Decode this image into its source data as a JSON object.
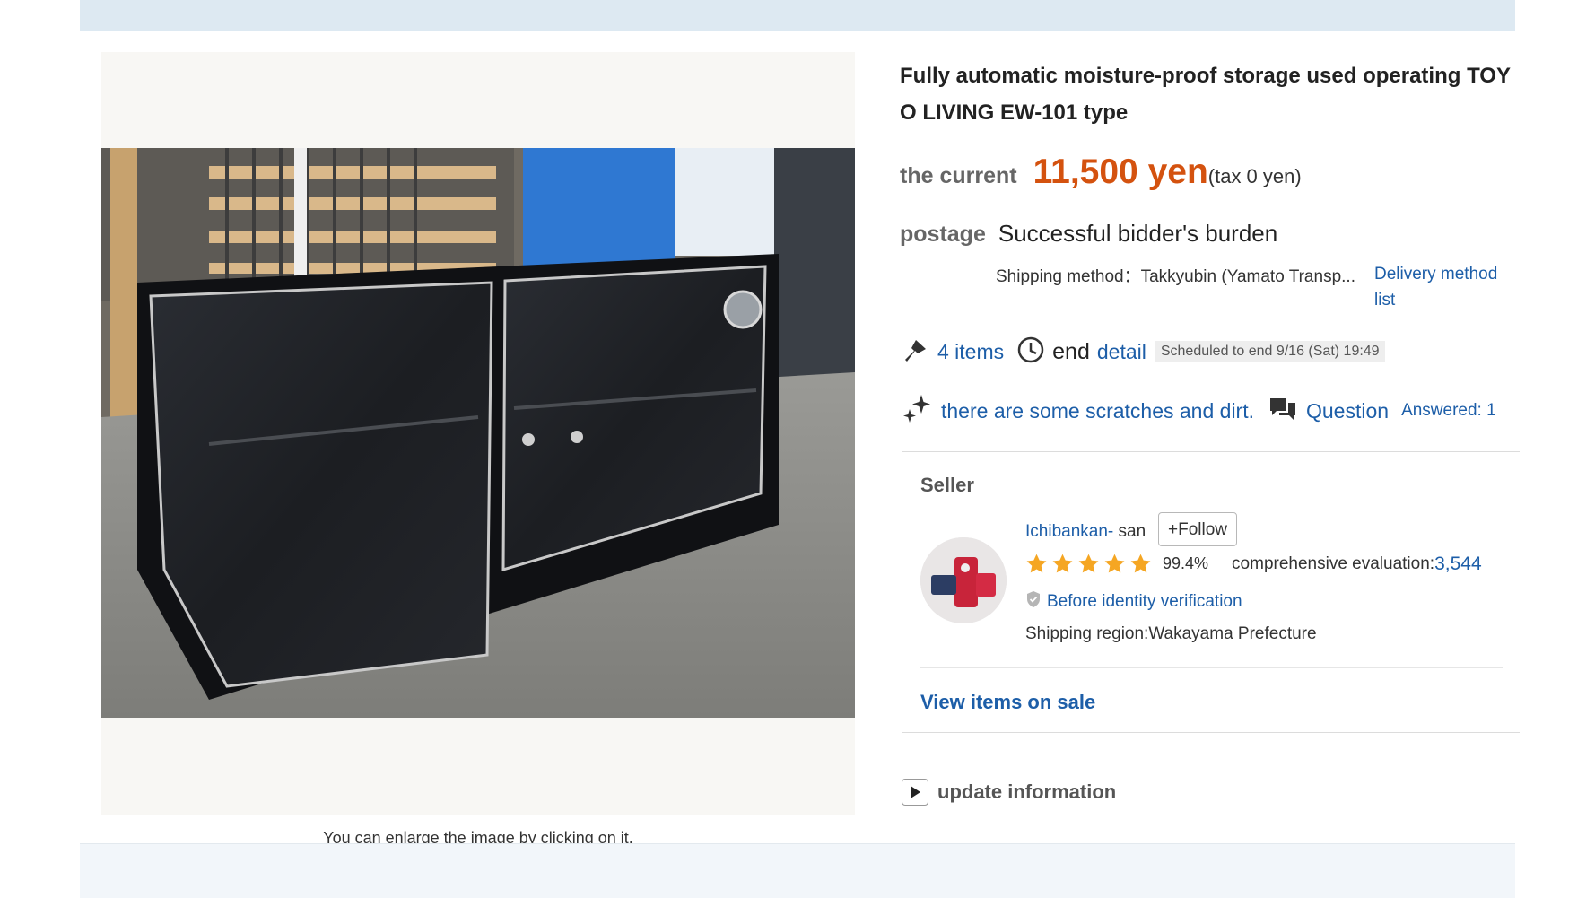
{
  "image": {
    "caption": "You can enlarge the image by clicking on it."
  },
  "item": {
    "title": "Fully automatic moisture-proof storage used operating TOYO LIVING EW-101 type"
  },
  "price": {
    "label": "the current",
    "amount": "11,500 yen",
    "tax": "(tax 0 yen)"
  },
  "postage": {
    "label": "postage",
    "value": "Successful bidder's burden",
    "shipping_method": "Shipping method：Takkyubin (Yamato Transp...",
    "delivery_link": "Delivery method list"
  },
  "auction": {
    "bids": "4 items",
    "end_label": "end",
    "detail_link": "detail",
    "scheduled": "Scheduled to end 9/16 (Sat) 19:49"
  },
  "condition": {
    "text": "there are some scratches and dirt.",
    "question_link": "Question",
    "answered": "Answered: 1"
  },
  "seller": {
    "heading": "Seller",
    "name": "Ichibankan-",
    "honorific": " san",
    "follow_label": "+Follow",
    "rating_percent": "99.4%",
    "stars": 5,
    "evaluation_label": "comprehensive evaluation:",
    "evaluation_count": "3,544",
    "verification": "Before identity verification",
    "region": "Shipping region:Wakayama Prefecture",
    "view_items": "View items on sale"
  },
  "update": {
    "label": "update information"
  },
  "colors": {
    "price": "#d4520f",
    "link": "#1d5ea8",
    "star": "#f5a623",
    "top_band": "#dde9f2"
  },
  "icons": [
    "gavel-icon",
    "clock-icon",
    "sparkle-icon",
    "chat-icon",
    "verify-shield-icon",
    "play-icon",
    "star-icon"
  ]
}
